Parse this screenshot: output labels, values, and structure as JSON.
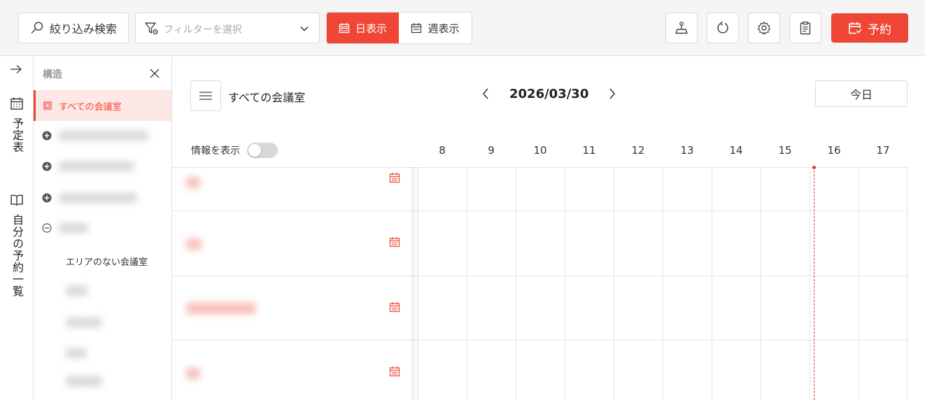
{
  "toolbar": {
    "search_label": "絞り込み検索",
    "filter_placeholder": "フィルターを選択",
    "day_view_label": "日表示",
    "week_view_label": "週表示",
    "reserve_label": "予約"
  },
  "rail": {
    "schedule_label": "予定表",
    "my_reservations_label": "自分の予約一覧"
  },
  "structure": {
    "title": "構造",
    "all_rooms_label": "すべての会議室",
    "no_area_label": "エリアのない会議室"
  },
  "main": {
    "room_scope": "すべての会議室",
    "date": "2026/03/30",
    "today_label": "今日",
    "show_info_label": "情報を表示",
    "hours": [
      "8",
      "9",
      "10",
      "11",
      "12",
      "13",
      "14",
      "15",
      "16",
      "17"
    ]
  },
  "colors": {
    "accent": "#ef4636",
    "accent_light": "#fde8e6",
    "grid_line": "#e3e3e3"
  },
  "icons": {
    "search": "search-icon",
    "filter": "filter-gear-icon",
    "calendar": "calendar-icon",
    "floor_map": "floor-map-icon",
    "refresh": "refresh-icon",
    "settings": "gear-icon",
    "clipboard": "clipboard-icon",
    "reserve": "calendar-check-icon"
  }
}
